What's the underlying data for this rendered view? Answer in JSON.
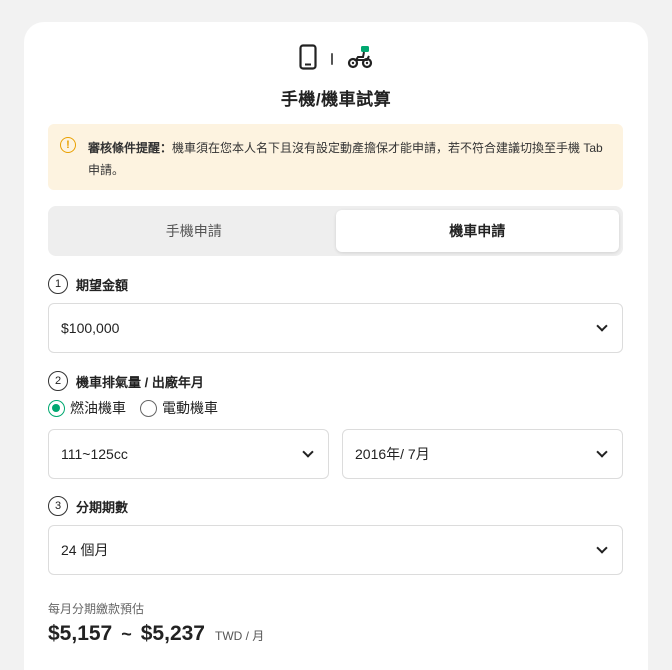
{
  "header": {
    "title": "手機/機車試算",
    "icons": [
      "phone-icon",
      "scooter-icon"
    ]
  },
  "notice": {
    "bold": "審核條件提醒：",
    "text": "機車須在您本人名下且沒有設定動產擔保才能申請，若不符合建議切換至手機 Tab 申請。"
  },
  "tabs": [
    {
      "label": "手機申請",
      "active": false
    },
    {
      "label": "機車申請",
      "active": true
    }
  ],
  "step1": {
    "num": "1",
    "label": "期望金額",
    "value": "$100,000"
  },
  "step2": {
    "num": "2",
    "label": "機車排氣量 / 出廠年月",
    "radios": [
      {
        "label": "燃油機車",
        "checked": true
      },
      {
        "label": "電動機車",
        "checked": false
      }
    ],
    "displacement": "111~125cc",
    "date": "2016年/ 7月"
  },
  "step3": {
    "num": "3",
    "label": "分期期數",
    "value": "24 個月"
  },
  "estimate": {
    "label": "每月分期繳款預估",
    "min": "$5,157",
    "sep": "~",
    "max": "$5,237",
    "unit": "TWD / 月"
  },
  "colors": {
    "accent": "#00a870",
    "warning": "#e9a000",
    "notice_bg": "#fdf3e0"
  }
}
